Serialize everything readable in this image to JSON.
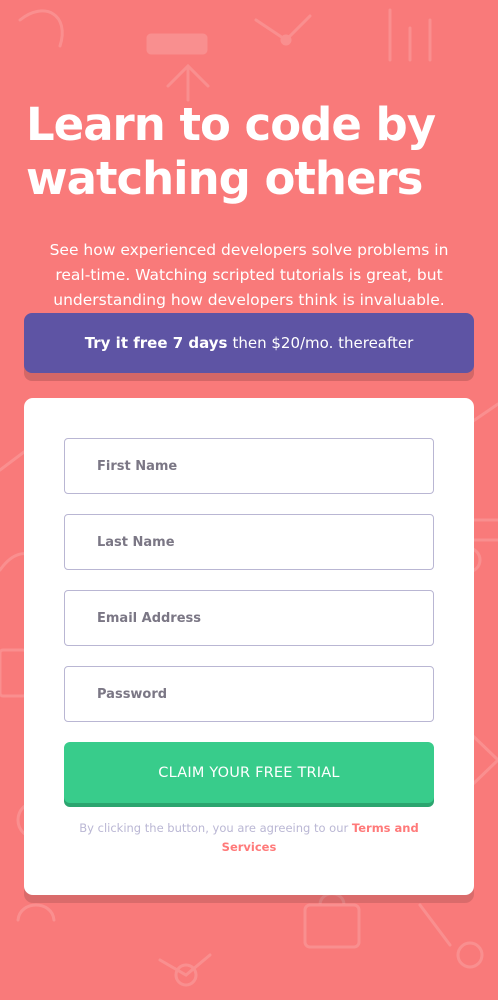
{
  "hero": {
    "title": "Learn to code by watching others",
    "subtitle": "See how experienced developers solve problems in real-time. Watching scripted tutorials is great, but understanding how developers think is invaluable."
  },
  "promo": {
    "bold_text": "Try it free 7 days",
    "regular_text": "then $20/mo. thereafter"
  },
  "form": {
    "first_name_placeholder": "First Name",
    "last_name_placeholder": "Last Name",
    "email_placeholder": "Email Address",
    "password_placeholder": "Password",
    "submit_label": "CLAIM YOUR FREE TRIAL",
    "terms_prefix": "By clicking the button, you are agreeing to our",
    "terms_link": "Terms and Services"
  },
  "colors": {
    "background": "#f97a7a",
    "promo": "#5e54a4",
    "cta": "#38cc8b",
    "cta_shadow": "#2ba56f",
    "card": "#ffffff",
    "terms_link": "#ff7a7a",
    "field_border": "#b9b6d3"
  }
}
